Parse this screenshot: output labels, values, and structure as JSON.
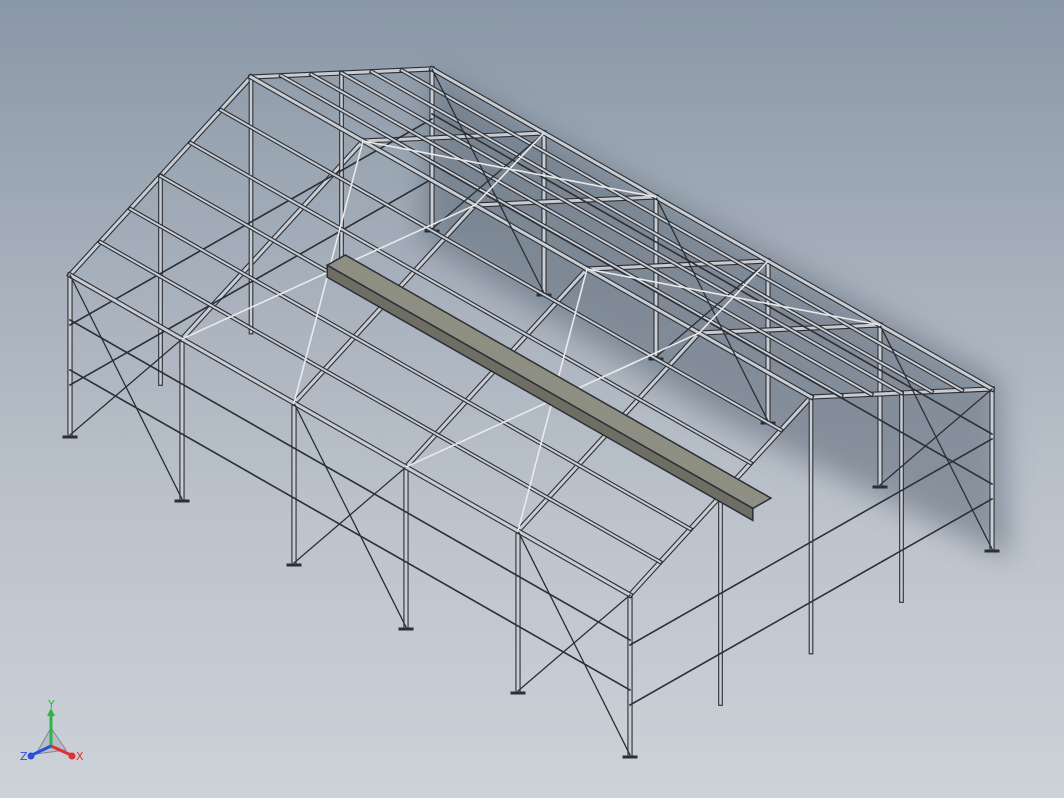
{
  "view": {
    "background_top": "#8a97a6",
    "background_bottom": "#cdd2d8"
  },
  "model": {
    "steel_color": "#2b2f36",
    "steel_light": "#c9cdd2",
    "crane_beam_color": "#8f8e82",
    "shadow_color": "#5e6a78"
  },
  "triad": {
    "x_label": "X",
    "y_label": "Y",
    "z_label": "Z",
    "x_color": "#e03030",
    "y_color": "#2fb34a",
    "z_color": "#2b4fd8"
  }
}
